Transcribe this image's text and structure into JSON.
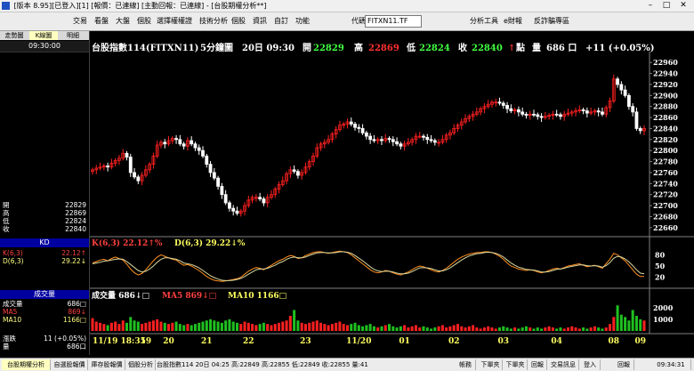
{
  "window": {
    "title": "[版本 8.95][已登入][1] [報價：已連線] [主動回報：已連線] - [台股期權分析**]"
  },
  "toolbar": {
    "menus": [
      "交易",
      "看盤",
      "大盤",
      "個股",
      "選擇權",
      "權證",
      "技術分析",
      "個股",
      "資訊",
      "自訂",
      "功能"
    ],
    "code_label": "代碼",
    "code_value": "FITXN11.TF",
    "right_items": [
      "分析工具",
      "e財報",
      "反詐騙專區"
    ]
  },
  "left_panel": {
    "tabs": [
      "走勢圖",
      "K線圖",
      "明細"
    ],
    "active_tab": "K線圖",
    "time": "09:30:00",
    "quote_rows": [
      {
        "label": "開",
        "value": "22829"
      },
      {
        "label": "高",
        "value": "22869"
      },
      {
        "label": "低",
        "value": "22824"
      },
      {
        "label": "收",
        "value": "22840"
      }
    ],
    "kd_title": "KD",
    "kd_rows": [
      {
        "label": "K(6,3)",
        "value": "22.12↑"
      },
      {
        "label": "D(6,3)",
        "value": "29.22↓"
      }
    ],
    "vol_title": "成交量",
    "vol_rows": [
      {
        "label": "成交量",
        "value": "686□"
      },
      {
        "label": "MA5",
        "value": "869↓"
      },
      {
        "label": "MA10",
        "value": "1166□"
      }
    ],
    "bottom_rows": [
      {
        "label": "漲跌",
        "value": "11 (+0.05%)"
      },
      {
        "label": "量",
        "value": "686口"
      }
    ]
  },
  "chart_header": {
    "name": "台股指數114(FITXN11)",
    "period": "5分鐘圖",
    "date_time": "20日 09:30",
    "open_label": "開",
    "open": "22829",
    "high_label": "高",
    "high": "22869",
    "low_label": "低",
    "low": "22824",
    "close_label": "收",
    "close": "22840",
    "unit": "點",
    "vol_label": "量",
    "volume": "686 口",
    "change": "+11 (+0.05%)"
  },
  "kd_header": {
    "k": "K(6,3) 22.12↑%",
    "d": "D(6,3) 29.22↓%"
  },
  "vol_header": {
    "vol": "成交量 686↓□",
    "ma5": "MA5 869↓□",
    "ma10": "MA10 1166□"
  },
  "colors": {
    "up": "#ff2020",
    "down": "#ffffff",
    "k_line": "#ff9020",
    "d_line": "#d8d8a0",
    "vol_up": "#ff2020",
    "vol_down": "#20c020"
  },
  "chart_data": {
    "type": "candlestick",
    "price_axis": {
      "ticks": [
        22660,
        22680,
        22700,
        22720,
        22740,
        22760,
        22780,
        22800,
        22820,
        22840,
        22860,
        22880,
        22900,
        22920,
        22940,
        22960
      ],
      "ylim": [
        22650,
        22970
      ]
    },
    "kd_axis": {
      "ticks": [
        20,
        50,
        80
      ],
      "ylim": [
        0,
        100
      ]
    },
    "vol_axis": {
      "ticks": [
        1000,
        2000
      ],
      "ylim": [
        0,
        2600
      ]
    },
    "x_labels": [
      {
        "label": "11/19 18:35",
        "i": 0
      },
      {
        "label": "19",
        "i": 14
      },
      {
        "label": "20",
        "i": 20
      },
      {
        "label": "21",
        "i": 30
      },
      {
        "label": "22",
        "i": 41
      },
      {
        "label": "23",
        "i": 56
      },
      {
        "label": "11/20",
        "i": 70
      },
      {
        "label": "01",
        "i": 82
      },
      {
        "label": "02",
        "i": 95
      },
      {
        "label": "03",
        "i": 108
      },
      {
        "label": "04",
        "i": 122
      },
      {
        "label": "08",
        "i": 137
      },
      {
        "label": "09",
        "i": 144
      }
    ],
    "close": [
      22765,
      22768,
      22770,
      22772,
      22770,
      22777,
      22782,
      22786,
      22795,
      22788,
      22760,
      22752,
      22745,
      22755,
      22765,
      22775,
      22790,
      22810,
      22815,
      22812,
      22818,
      22822,
      22820,
      22812,
      22808,
      22818,
      22812,
      22805,
      22800,
      22790,
      22775,
      22760,
      22750,
      22735,
      22720,
      22705,
      22695,
      22690,
      22686,
      22690,
      22700,
      22710,
      22715,
      22715,
      22712,
      22705,
      22715,
      22720,
      22730,
      22738,
      22745,
      22758,
      22765,
      22762,
      22755,
      22760,
      22770,
      22780,
      22790,
      22805,
      22812,
      22815,
      22820,
      22830,
      22838,
      22846,
      22848,
      22852,
      22848,
      22842,
      22840,
      22832,
      22826,
      22820,
      22818,
      22820,
      22818,
      22822,
      22820,
      22816,
      22812,
      22808,
      22812,
      22815,
      22820,
      22826,
      22826,
      22824,
      22820,
      22818,
      22815,
      22815,
      22820,
      22828,
      22832,
      22840,
      22846,
      22852,
      22858,
      22862,
      22866,
      22870,
      22876,
      22880,
      22884,
      22888,
      22888,
      22886,
      22882,
      22876,
      22872,
      22874,
      22870,
      22866,
      22864,
      22866,
      22865,
      22862,
      22860,
      22862,
      22864,
      22866,
      22865,
      22862,
      22866,
      22868,
      22870,
      22872,
      22874,
      22872,
      22868,
      22870,
      22872,
      22870,
      22866,
      22878,
      22890,
      22930,
      22920,
      22910,
      22900,
      22880,
      22870,
      22840,
      22836,
      22840
    ],
    "k": [
      58,
      62,
      66,
      68,
      64,
      70,
      74,
      70,
      66,
      55,
      42,
      32,
      26,
      30,
      40,
      52,
      64,
      74,
      80,
      76,
      72,
      68,
      66,
      58,
      52,
      54,
      50,
      44,
      38,
      30,
      22,
      16,
      12,
      10,
      9,
      10,
      12,
      14,
      16,
      20,
      28,
      36,
      42,
      46,
      44,
      40,
      46,
      52,
      58,
      64,
      68,
      74,
      78,
      76,
      70,
      72,
      78,
      82,
      86,
      88,
      88,
      86,
      84,
      86,
      88,
      90,
      88,
      86,
      80,
      72,
      64,
      56,
      48,
      40,
      34,
      32,
      34,
      38,
      36,
      32,
      28,
      26,
      30,
      34,
      40,
      46,
      50,
      48,
      44,
      40,
      36,
      34,
      38,
      44,
      52,
      60,
      68,
      74,
      78,
      82,
      84,
      86,
      86,
      88,
      88,
      86,
      82,
      76,
      68,
      58,
      50,
      46,
      42,
      40,
      38,
      40,
      38,
      34,
      32,
      34,
      38,
      42,
      44,
      42,
      46,
      50,
      52,
      54,
      56,
      52,
      48,
      50,
      52,
      48,
      44,
      56,
      68,
      84,
      80,
      72,
      64,
      52,
      40,
      28,
      22,
      22
    ],
    "d": [
      56,
      58,
      60,
      63,
      64,
      66,
      68,
      69,
      68,
      62,
      54,
      46,
      38,
      34,
      36,
      42,
      50,
      60,
      68,
      72,
      72,
      70,
      68,
      64,
      58,
      56,
      54,
      50,
      45,
      38,
      31,
      24,
      19,
      15,
      12,
      11,
      11,
      12,
      14,
      17,
      22,
      28,
      34,
      40,
      42,
      42,
      44,
      48,
      52,
      58,
      62,
      68,
      72,
      74,
      72,
      72,
      74,
      78,
      82,
      85,
      86,
      86,
      85,
      85,
      86,
      88,
      88,
      87,
      84,
      78,
      71,
      64,
      56,
      48,
      41,
      37,
      35,
      36,
      36,
      34,
      31,
      29,
      29,
      31,
      35,
      40,
      45,
      46,
      45,
      43,
      40,
      37,
      37,
      40,
      45,
      52,
      59,
      66,
      72,
      77,
      80,
      83,
      84,
      86,
      87,
      86,
      84,
      80,
      74,
      66,
      58,
      52,
      47,
      44,
      41,
      40,
      39,
      37,
      34,
      34,
      35,
      38,
      41,
      42,
      44,
      47,
      49,
      51,
      53,
      53,
      51,
      50,
      51,
      50,
      47,
      51,
      59,
      71,
      76,
      74,
      69,
      61,
      51,
      40,
      31,
      29
    ],
    "volume": [
      1100,
      800,
      700,
      600,
      500,
      700,
      800,
      600,
      900,
      700,
      1200,
      900,
      800,
      600,
      700,
      800,
      900,
      1000,
      800,
      700,
      600,
      700,
      800,
      600,
      500,
      600,
      500,
      600,
      700,
      800,
      900,
      1000,
      900,
      800,
      700,
      900,
      1000,
      800,
      700,
      600,
      800,
      700,
      600,
      500,
      600,
      700,
      600,
      500,
      600,
      700,
      800,
      900,
      1300,
      1800,
      900,
      700,
      600,
      700,
      800,
      900,
      700,
      600,
      500,
      600,
      700,
      800,
      600,
      500,
      600,
      700,
      500,
      400,
      500,
      600,
      400,
      300,
      400,
      500,
      600,
      400,
      300,
      400,
      500,
      300,
      400,
      500,
      300,
      400,
      300,
      200,
      300,
      400,
      500,
      300,
      400,
      500,
      600,
      400,
      300,
      400,
      500,
      300,
      200,
      300,
      400,
      300,
      200,
      300,
      400,
      300,
      200,
      300,
      200,
      300,
      400,
      300,
      200,
      300,
      200,
      300,
      400,
      300,
      200,
      300,
      200,
      300,
      400,
      300,
      200,
      300,
      200,
      300,
      400,
      300,
      200,
      300,
      600,
      1200,
      2200,
      1400,
      1200,
      900,
      1800,
      1300,
      1000,
      900,
      686
    ]
  },
  "status_bar": {
    "tabs": [
      "台股期權分析",
      "自選股報價",
      "庫存股報價",
      "個股分析"
    ],
    "active_tab": "台股期權分析",
    "ticker": "台股指數114 20日 04:25 高:22849 高:22855 低:22849 收:22855 量:41",
    "right_items": [
      "帳務",
      "下單夾",
      "下單夾",
      "回報",
      "交易訊息",
      "登入",
      "回報"
    ],
    "clock": "09:34:31"
  }
}
